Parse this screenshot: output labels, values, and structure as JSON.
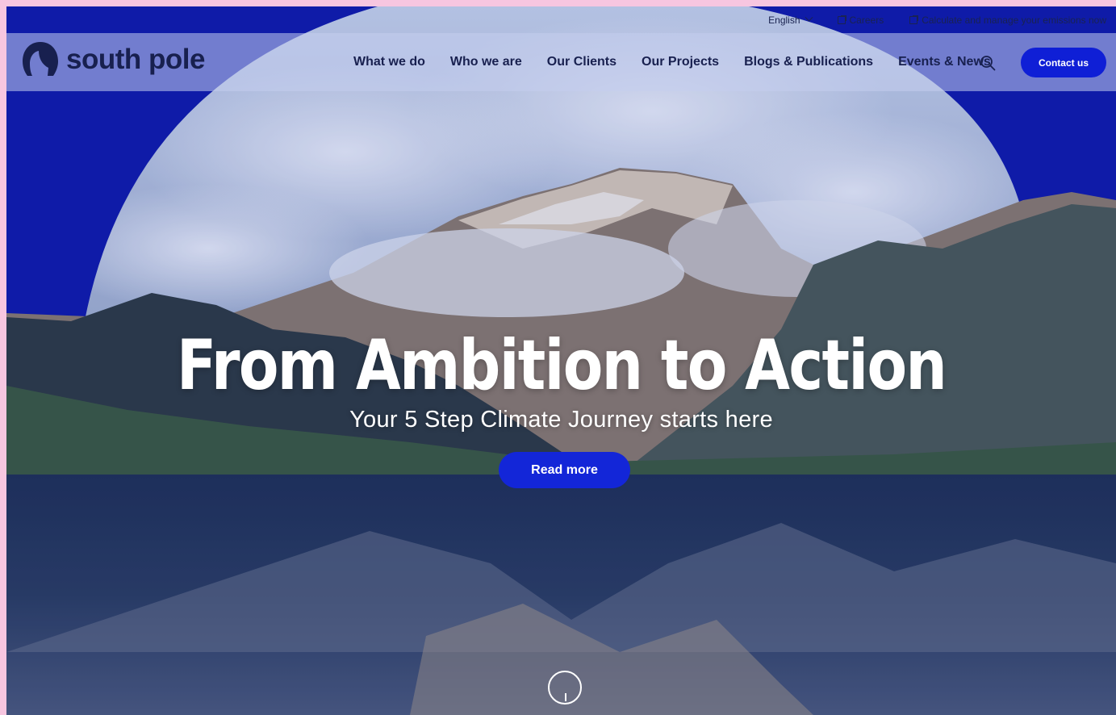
{
  "utility": {
    "language": "English",
    "careers": "Careers",
    "calculate": "Calculate and manage your emissions now"
  },
  "brand": {
    "name": "south pole"
  },
  "nav": {
    "items": [
      {
        "label": "What we do"
      },
      {
        "label": "Who we are"
      },
      {
        "label": "Our Clients"
      },
      {
        "label": "Our Projects"
      },
      {
        "label": "Blogs & Publications"
      },
      {
        "label": "Events & News"
      }
    ],
    "contact_label": "Contact us"
  },
  "hero": {
    "title": "From Ambition to Action",
    "subtitle": "Your 5 Step Climate Journey starts here",
    "cta_label": "Read more"
  },
  "colors": {
    "accent": "#0f1fd6",
    "navy": "#18204f",
    "frame": "#f7c6e0"
  }
}
